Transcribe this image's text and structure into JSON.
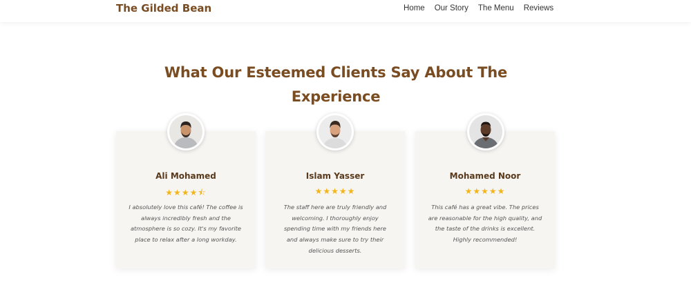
{
  "header": {
    "brand": "The Gilded Bean",
    "nav": [
      "Home",
      "Our Story",
      "The Menu",
      "Reviews"
    ]
  },
  "section": {
    "title": "What Our Esteemed Clients Say About The Experience"
  },
  "testimonials": [
    {
      "name": "Ali Mohamed",
      "rating": 4.5,
      "stars": "★★★★⯪",
      "quote": "I absolutely love this café! The coffee is always incredibly fresh and the atmosphere is so cozy. It's my favorite place to relax after a long workday."
    },
    {
      "name": "Islam Yasser",
      "rating": 5,
      "stars": "★★★★★",
      "quote": "The staff here are truly friendly and welcoming. I thoroughly enjoy spending time with my friends here and always make sure to try their delicious desserts."
    },
    {
      "name": "Mohamed Noor",
      "rating": 5,
      "stars": "★★★★★",
      "quote": "This café has a great vibe. The prices are reasonable for the high quality, and the taste of the drinks is excellent. Highly recommended!"
    }
  ],
  "colors": {
    "brand": "#7a4c22",
    "star": "#f2b61c",
    "card_bg": "#f7f5f2"
  }
}
